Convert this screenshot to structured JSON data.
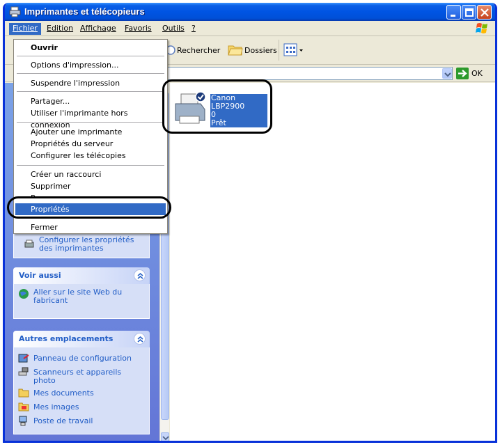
{
  "window": {
    "title": "Imprimantes et télécopieurs"
  },
  "menubar": {
    "items": [
      "Fichier",
      "Edition",
      "Affichage",
      "Favoris",
      "Outils",
      "?"
    ]
  },
  "toolbar": {
    "search_label": "Rechercher",
    "folders_label": "Dossiers"
  },
  "address": {
    "go_label": "OK"
  },
  "file_menu": {
    "items": [
      {
        "label": "Ouvrir",
        "bold": true
      },
      {
        "label": "Options d'impression..."
      },
      {
        "label": "Suspendre l'impression"
      },
      {
        "label": "Partager..."
      },
      {
        "label": "Utiliser l'imprimante hors connexion"
      },
      {
        "label": "Ajouter une imprimante"
      },
      {
        "label": "Propriétés du serveur"
      },
      {
        "label": "Configurer les télécopies"
      },
      {
        "label": "Créer un raccourci"
      },
      {
        "label": "Supprimer"
      },
      {
        "label": "Renommer"
      },
      {
        "label": "Propriétés",
        "selected": true
      },
      {
        "label": "Fermer"
      }
    ]
  },
  "task_panel": {
    "configure_link": "Configurer les propriétés des imprimantes"
  },
  "see_also": {
    "title": "Voir aussi",
    "links": [
      "Aller sur le site Web du fabricant"
    ]
  },
  "other_places": {
    "title": "Autres emplacements",
    "links": [
      "Panneau de configuration",
      "Scanneurs et appareils photo",
      "Mes documents",
      "Mes images",
      "Poste de travail"
    ]
  },
  "printer": {
    "name": "Canon LBP2900",
    "jobs": "0",
    "status": "Prêt"
  },
  "colors": {
    "titlebar": "#0054e3",
    "selection": "#316ac5",
    "link": "#215dc6"
  }
}
